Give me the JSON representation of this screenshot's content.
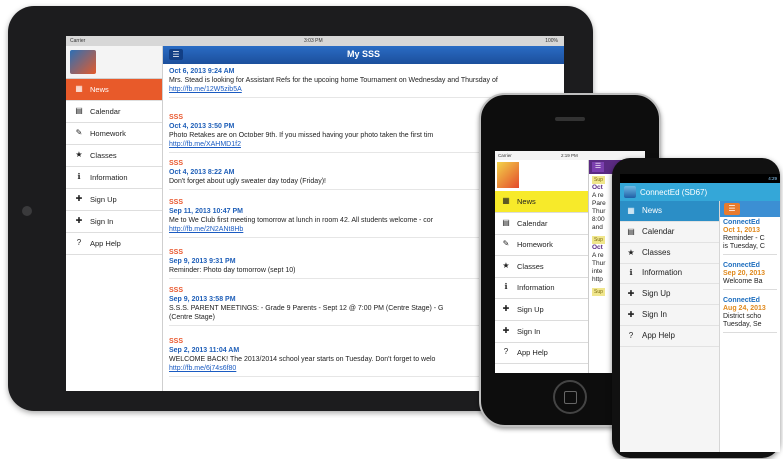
{
  "ipad": {
    "status": {
      "carrier": "Carrier",
      "time": "3:03 PM",
      "battery": "100%"
    },
    "header_title": "My SSS",
    "menu_icon": "list-icon",
    "sidebar": [
      {
        "label": "News",
        "icon": "news-icon",
        "glyph": "▦",
        "active": true
      },
      {
        "label": "Calendar",
        "icon": "calendar-icon",
        "glyph": "▤",
        "active": false
      },
      {
        "label": "Homework",
        "icon": "homework-icon",
        "glyph": "✎",
        "active": false
      },
      {
        "label": "Classes",
        "icon": "star-icon",
        "glyph": "★",
        "active": false
      },
      {
        "label": "Information",
        "icon": "info-icon",
        "glyph": "ℹ",
        "active": false
      },
      {
        "label": "Sign Up",
        "icon": "user-add-icon",
        "glyph": "✚",
        "active": false
      },
      {
        "label": "Sign In",
        "icon": "user-icon",
        "glyph": "✚",
        "active": false
      },
      {
        "label": "App Help",
        "icon": "help-icon",
        "glyph": "?",
        "active": false
      }
    ],
    "posts": [
      {
        "source": "",
        "date": "Oct 6, 2013 9:24 AM",
        "text": "Mrs. Stead is looking for Assistant Refs for the upcoing home Tournament on Wednesday and Thursday of",
        "text2": "",
        "link": "http://fb.me/12W5zib5A"
      },
      {
        "source": "SSS",
        "date": "Oct 4, 2013 3:50 PM",
        "text": "Photo Retakes are on October 9th. If you missed having your photo taken the first tim",
        "text2": "",
        "link": "http://fb.me/XAHMD1f2"
      },
      {
        "source": "SSS",
        "date": "Oct 4, 2013 8:22 AM",
        "text": "Don't forget about ugly sweater day today (Friday)!",
        "text2": "",
        "link": ""
      },
      {
        "source": "SSS",
        "date": "Sep 11, 2013 10:47 PM",
        "text": "Me to We Club first meeting tomorrow at lunch in room 42. All students welcome - cor",
        "text2": "",
        "link": "http://fb.me/2N2ANt8Hb"
      },
      {
        "source": "SSS",
        "date": "Sep 9, 2013 9:31 PM",
        "text": "Reminder: Photo day tomorrow (sept 10)",
        "text2": "",
        "link": ""
      },
      {
        "source": "SSS",
        "date": "Sep 9, 2013 3:58 PM",
        "text": "S.S.S. PARENT MEETINGS: - Grade 9 Parents - Sept 12 @ 7:00 PM (Centre Stage) - G",
        "text2": "(Centre Stage)",
        "link": ""
      },
      {
        "source": "SSS",
        "date": "Sep 2, 2013 11:04 AM",
        "text": "WELCOME BACK! The 2013/2014 school year starts on Tuesday. Don't forget to welo",
        "text2": "",
        "link": "http://fb.me/6j74s6f80"
      }
    ]
  },
  "iphone": {
    "status": {
      "carrier": "Carrier",
      "time": "2:19 PM"
    },
    "sidebar": [
      {
        "label": "News",
        "glyph": "▦",
        "active": true
      },
      {
        "label": "Calendar",
        "glyph": "▤",
        "active": false
      },
      {
        "label": "Homework",
        "glyph": "✎",
        "active": false
      },
      {
        "label": "Classes",
        "glyph": "★",
        "active": false
      },
      {
        "label": "Information",
        "glyph": "ℹ",
        "active": false
      },
      {
        "label": "Sign Up",
        "glyph": "✚",
        "active": false
      },
      {
        "label": "Sign In",
        "glyph": "✚",
        "active": false
      },
      {
        "label": "App Help",
        "glyph": "?",
        "active": false
      }
    ],
    "feed": [
      {
        "tag": "Sup",
        "date": "Oct",
        "lines": [
          "A re",
          "Pare",
          "Thur",
          "8:00",
          "and"
        ]
      },
      {
        "tag": "Sup",
        "date": "Oct",
        "lines": [
          "A re",
          "Thur",
          "inte",
          "http"
        ]
      },
      {
        "tag": "Sup",
        "date": "",
        "lines": []
      }
    ]
  },
  "android": {
    "status_time": "4:29",
    "app_title": "ConnectEd (SD67)",
    "sidebar": [
      {
        "label": "News",
        "glyph": "▦",
        "active": true
      },
      {
        "label": "Calendar",
        "glyph": "▤",
        "active": false
      },
      {
        "label": "Classes",
        "glyph": "★",
        "active": false
      },
      {
        "label": "Information",
        "glyph": "ℹ",
        "active": false
      },
      {
        "label": "Sign Up",
        "glyph": "✚",
        "active": false
      },
      {
        "label": "Sign In",
        "glyph": "✚",
        "active": false
      },
      {
        "label": "App Help",
        "glyph": "?",
        "active": false
      }
    ],
    "feed": [
      {
        "source": "ConnectEd",
        "date": "Oct 1, 2013",
        "lines": [
          "Reminder - C",
          "is Tuesday, C"
        ]
      },
      {
        "source": "ConnectEd",
        "date": "Sep 20, 2013",
        "lines": [
          "Welcome Ba"
        ]
      },
      {
        "source": "ConnectEd",
        "date": "Aug 24, 2013",
        "lines": [
          "District scho",
          "Tuesday, Se"
        ]
      }
    ]
  }
}
